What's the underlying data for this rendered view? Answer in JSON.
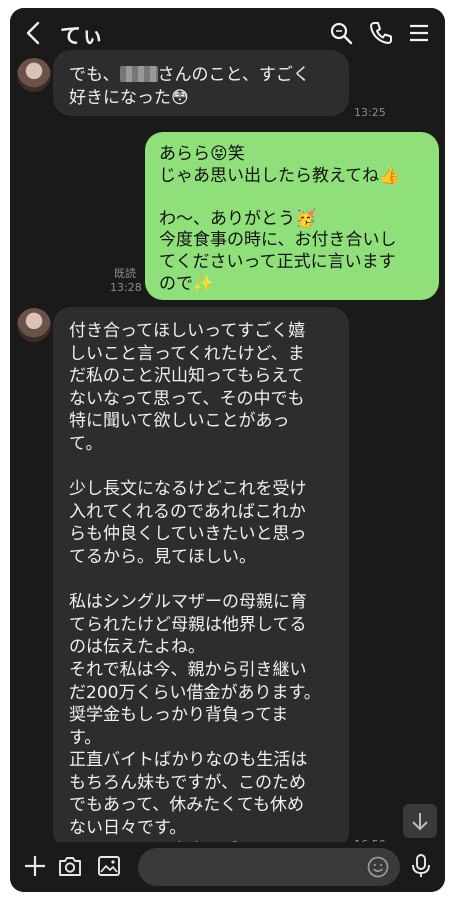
{
  "header": {
    "title": "てぃ",
    "icons": [
      "back-icon",
      "search-icon",
      "phone-icon",
      "menu-icon"
    ]
  },
  "messages": [
    {
      "side": "in",
      "text_before": "でも、",
      "text_after": "さんのこと、すごく\n好きになった😳",
      "time": "13:25"
    },
    {
      "side": "out",
      "text": "あらら😝笑\nじゃあ思い出したら教えてね👍\n\nわ〜、ありがとう🥳\n今度食事の時に、お付き合いし\nてくださいって正式に言います\nので✨",
      "read": "既読",
      "time": "13:28"
    },
    {
      "side": "in",
      "text": "付き合ってほしいってすごく嬉\nしいこと言ってくれたけど、ま\nだ私のこと沢山知ってもらえて\nないなって思って、その中でも\n特に聞いて欲しいことがあっ\nて。\n\n少し長文になるけどこれを受け\n入れてくれるのであればこれか\nらも仲良くしていきたいと思っ\nてるから。見てほしい。\n\n私はシングルマザーの母親に育\nてられたけど母親は他界してる\nのは伝えたよね。\nそれで私は今、親から引き継い\nだ200万くらい借金があります。\n奨学金もしっかり背負ってま\nす。\n正直バイトばかりなのも生活は\nもちろん妹もですが、このため\nでもあって、休みたくても休め\nない日々です。\nこんな私でも本当に受け入れて\nくれますか。",
      "time": "16:50"
    }
  ],
  "footer": {
    "icons": [
      "plus-icon",
      "camera-icon",
      "image-icon",
      "emoji-icon",
      "mic-icon"
    ]
  },
  "colors": {
    "background": "#1a1a1a",
    "incoming": "#2d2d2d",
    "outgoing": "#8fe07a",
    "muted": "#8c8c8c"
  }
}
